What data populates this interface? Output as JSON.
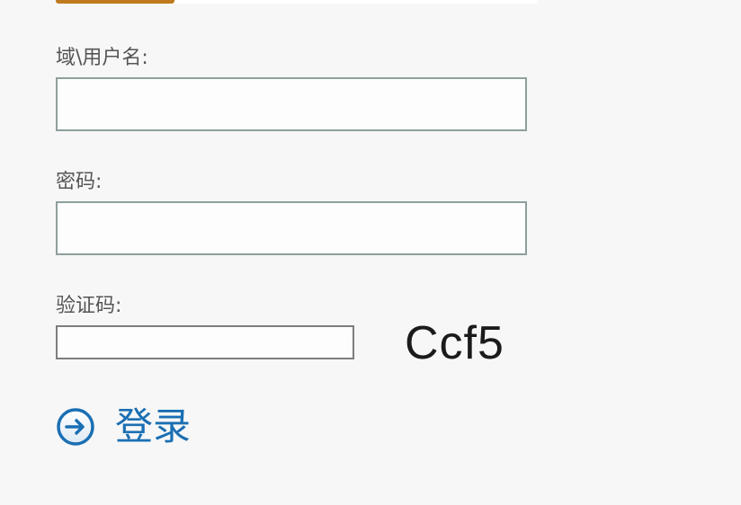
{
  "form": {
    "username_label": "域\\用户名:",
    "username_value": "",
    "password_label": "密码:",
    "password_value": "",
    "captcha_label": "验证码:",
    "captcha_value": "",
    "captcha_text": "Ccf5",
    "login_label": "登录"
  },
  "colors": {
    "accent": "#c07a1e",
    "button_blue": "#1a6fb3",
    "input_border": "#8e9f9d",
    "background": "#f7f7f7"
  },
  "icons": {
    "login": "arrow-right-circle-icon"
  }
}
